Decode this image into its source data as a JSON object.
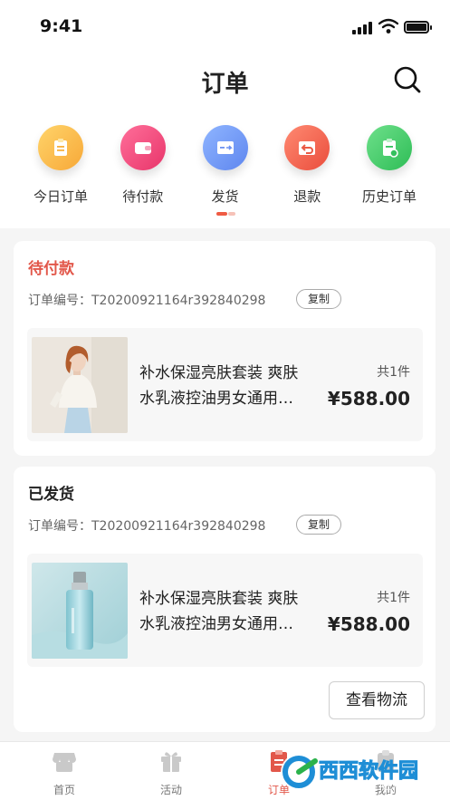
{
  "status_bar": {
    "time": "9:41"
  },
  "header": {
    "title": "订单"
  },
  "categories": [
    {
      "label": "今日订单",
      "icon": "clipboard-icon"
    },
    {
      "label": "待付款",
      "icon": "wallet-icon"
    },
    {
      "label": "发货",
      "icon": "shipping-card-icon"
    },
    {
      "label": "退款",
      "icon": "refund-icon"
    },
    {
      "label": "历史订单",
      "icon": "history-icon"
    }
  ],
  "orders": [
    {
      "status": "待付款",
      "order_no": "订单编号：T20200921164r392840298",
      "copy_label": "复制",
      "product_line1": "补水保湿亮肤套装 爽肤",
      "product_line2": "水乳液控油男女通用…",
      "count": "共1件",
      "price": "¥588.00"
    },
    {
      "status": "已发货",
      "order_no": "订单编号：T20200921164r392840298",
      "copy_label": "复制",
      "product_line1": "补水保湿亮肤套装 爽肤",
      "product_line2": "水乳液控油男女通用…",
      "count": "共1件",
      "price": "¥588.00",
      "action_label": "查看物流"
    }
  ],
  "tabbar": [
    {
      "label": "首页",
      "icon": "store-icon"
    },
    {
      "label": "活动",
      "icon": "gift-icon"
    },
    {
      "label": "订单",
      "icon": "order-icon",
      "active": true
    },
    {
      "label": "我的",
      "icon": "profile-icon"
    }
  ],
  "watermark": {
    "text": "西西软件园",
    "subtext": "CR173.COM"
  },
  "colors": {
    "accent": "#e2574a",
    "background": "#f5f5f5"
  }
}
